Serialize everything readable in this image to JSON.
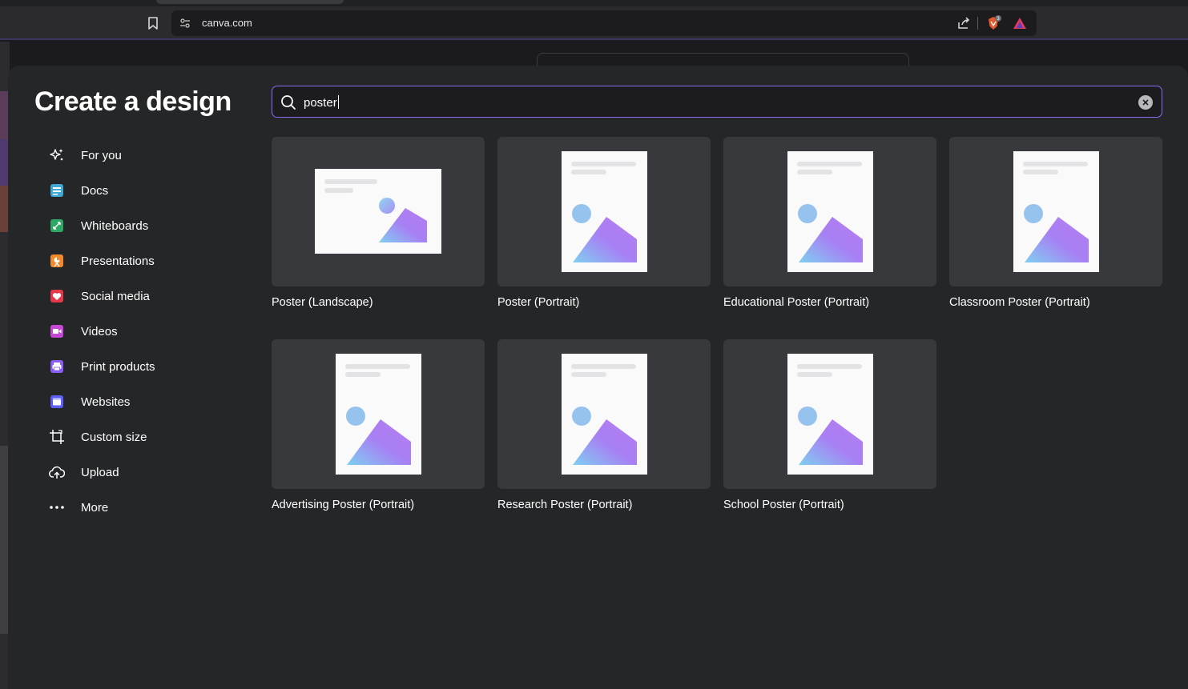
{
  "browser": {
    "url": "canva.com",
    "brave_shield_count": "3"
  },
  "modal": {
    "title": "Create a design",
    "nav": [
      {
        "label": "For you",
        "icon": "sparkle-icon"
      },
      {
        "label": "Docs",
        "icon": "docs-icon"
      },
      {
        "label": "Whiteboards",
        "icon": "whiteboard-icon"
      },
      {
        "label": "Presentations",
        "icon": "presentation-icon"
      },
      {
        "label": "Social media",
        "icon": "heart-icon"
      },
      {
        "label": "Videos",
        "icon": "video-icon"
      },
      {
        "label": "Print products",
        "icon": "printer-icon"
      },
      {
        "label": "Websites",
        "icon": "website-icon"
      },
      {
        "label": "Custom size",
        "icon": "crop-icon"
      },
      {
        "label": "Upload",
        "icon": "upload-cloud-icon"
      },
      {
        "label": "More",
        "icon": "more-dots-icon"
      }
    ],
    "search": {
      "value": "poster"
    },
    "results": [
      {
        "label": "Poster (Landscape)",
        "orientation": "landscape"
      },
      {
        "label": "Poster (Portrait)",
        "orientation": "portrait"
      },
      {
        "label": "Educational Poster (Portrait)",
        "orientation": "portrait"
      },
      {
        "label": "Classroom Poster (Portrait)",
        "orientation": "portrait"
      },
      {
        "label": "Advertising Poster (Portrait)",
        "orientation": "portrait"
      },
      {
        "label": "Research Poster (Portrait)",
        "orientation": "portrait"
      },
      {
        "label": "School Poster (Portrait)",
        "orientation": "portrait"
      }
    ]
  },
  "colors": {
    "accent": "#8b6cf6",
    "modal_bg": "#252628",
    "card_bg": "#38393c"
  }
}
